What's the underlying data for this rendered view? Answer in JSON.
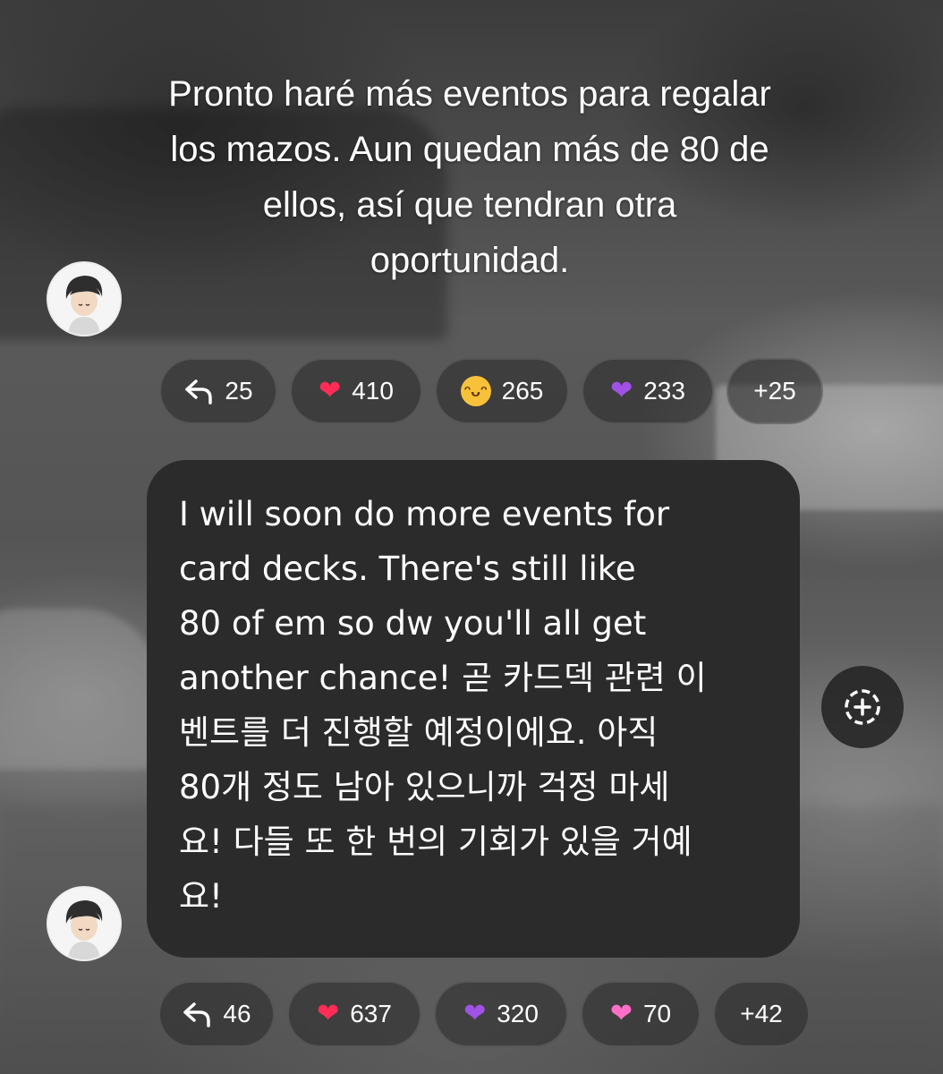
{
  "message_1": {
    "text": "Pronto haré más eventos para regalar\nlos mazos. Aun quedan más de 80 de\nellos, así que tendran otra\noportunidad.",
    "avatar": "user-avatar",
    "reactions": [
      {
        "icon": "reply-icon",
        "count": "25"
      },
      {
        "icon": "red-heart-icon",
        "count": "410"
      },
      {
        "icon": "laughing-face-icon",
        "count": "265"
      },
      {
        "icon": "purple-heart-icon",
        "count": "233"
      },
      {
        "count": "+25"
      }
    ]
  },
  "message_2": {
    "text": "I will soon do more events for\ncard decks. There's still like\n80 of em so dw you'll all get\nanother chance! 곧 카드덱 관련 이\n벤트를 더 진행할 예정이에요. 아직\n80개 정도 남아 있으니까 걱정 마세\n요! 다들 또 한 번의 기회가 있을 거예\n요!",
    "avatar": "user-avatar",
    "reactions": [
      {
        "icon": "reply-icon",
        "count": "46"
      },
      {
        "icon": "red-heart-icon",
        "count": "637"
      },
      {
        "icon": "purple-heart-icon",
        "count": "320"
      },
      {
        "icon": "pink-heart-icon",
        "count": "70"
      },
      {
        "count": "+42"
      }
    ]
  },
  "add_reaction_button": {
    "icon": "add-reaction-icon"
  },
  "colors": {
    "bubble": "#2b2b2b",
    "red_heart": "#ff2d55",
    "purple_heart": "#a052e6",
    "pink_heart": "#ff6ec7"
  }
}
